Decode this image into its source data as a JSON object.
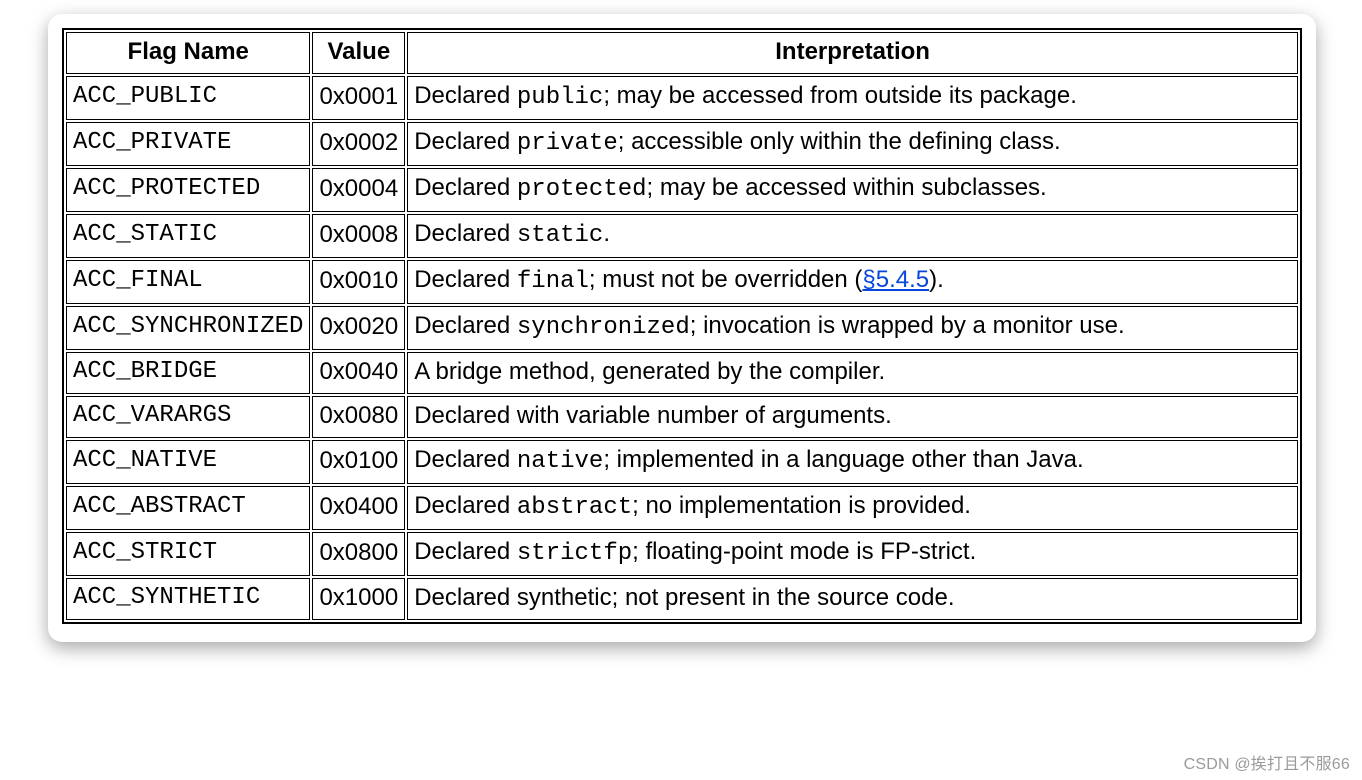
{
  "headers": {
    "flag": "Flag Name",
    "value": "Value",
    "interp": "Interpretation"
  },
  "rows": [
    {
      "flag": "ACC_PUBLIC",
      "value": "0x0001",
      "interp_pre": "Declared ",
      "interp_code": "public",
      "interp_post": "; may be accessed from outside its package.",
      "link_text": "",
      "link_tail": ""
    },
    {
      "flag": "ACC_PRIVATE",
      "value": "0x0002",
      "interp_pre": "Declared ",
      "interp_code": "private",
      "interp_post": "; accessible only within the defining class.",
      "link_text": "",
      "link_tail": ""
    },
    {
      "flag": "ACC_PROTECTED",
      "value": "0x0004",
      "interp_pre": "Declared ",
      "interp_code": "protected",
      "interp_post": "; may be accessed within subclasses.",
      "link_text": "",
      "link_tail": ""
    },
    {
      "flag": "ACC_STATIC",
      "value": "0x0008",
      "interp_pre": "Declared ",
      "interp_code": "static",
      "interp_post": ".",
      "link_text": "",
      "link_tail": ""
    },
    {
      "flag": "ACC_FINAL",
      "value": "0x0010",
      "interp_pre": "Declared ",
      "interp_code": "final",
      "interp_post": "; must not be overridden (",
      "link_text": "§5.4.5",
      "link_tail": ")."
    },
    {
      "flag": "ACC_SYNCHRONIZED",
      "value": "0x0020",
      "interp_pre": "Declared ",
      "interp_code": "synchronized",
      "interp_post": "; invocation is wrapped by a monitor use.",
      "link_text": "",
      "link_tail": ""
    },
    {
      "flag": "ACC_BRIDGE",
      "value": "0x0040",
      "interp_pre": "A bridge method, generated by the compiler.",
      "interp_code": "",
      "interp_post": "",
      "link_text": "",
      "link_tail": ""
    },
    {
      "flag": "ACC_VARARGS",
      "value": "0x0080",
      "interp_pre": "Declared with variable number of arguments.",
      "interp_code": "",
      "interp_post": "",
      "link_text": "",
      "link_tail": ""
    },
    {
      "flag": "ACC_NATIVE",
      "value": "0x0100",
      "interp_pre": "Declared ",
      "interp_code": "native",
      "interp_post": "; implemented in a language other than Java.",
      "link_text": "",
      "link_tail": ""
    },
    {
      "flag": "ACC_ABSTRACT",
      "value": "0x0400",
      "interp_pre": "Declared ",
      "interp_code": "abstract",
      "interp_post": "; no implementation is provided.",
      "link_text": "",
      "link_tail": ""
    },
    {
      "flag": "ACC_STRICT",
      "value": "0x0800",
      "interp_pre": "Declared ",
      "interp_code": "strictfp",
      "interp_post": "; floating-point mode is FP-strict.",
      "link_text": "",
      "link_tail": ""
    },
    {
      "flag": "ACC_SYNTHETIC",
      "value": "0x1000",
      "interp_pre": "Declared synthetic; not present in the source code.",
      "interp_code": "",
      "interp_post": "",
      "link_text": "",
      "link_tail": ""
    }
  ],
  "watermark": "CSDN @挨打且不服66"
}
